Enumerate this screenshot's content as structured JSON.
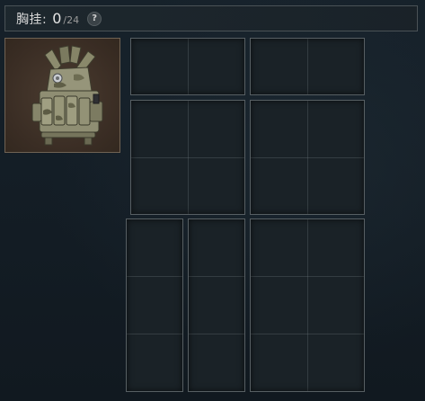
{
  "header": {
    "title": "胸挂:",
    "count": "0",
    "capacity": "/24",
    "help_icon": "?"
  },
  "item": {
    "icon": "chest-rig-icon"
  },
  "slots": [
    {
      "id": "a",
      "cols": 2,
      "rows": 1
    },
    {
      "id": "b",
      "cols": 2,
      "rows": 1
    },
    {
      "id": "c",
      "cols": 2,
      "rows": 2
    },
    {
      "id": "d",
      "cols": 2,
      "rows": 2
    },
    {
      "id": "e",
      "cols": 1,
      "rows": 3
    },
    {
      "id": "f",
      "cols": 1,
      "rows": 3
    },
    {
      "id": "g",
      "cols": 2,
      "rows": 3
    }
  ],
  "colors": {
    "background": "#131b22",
    "slot_border": "#575f63",
    "item_frame": "#3a2d24"
  }
}
